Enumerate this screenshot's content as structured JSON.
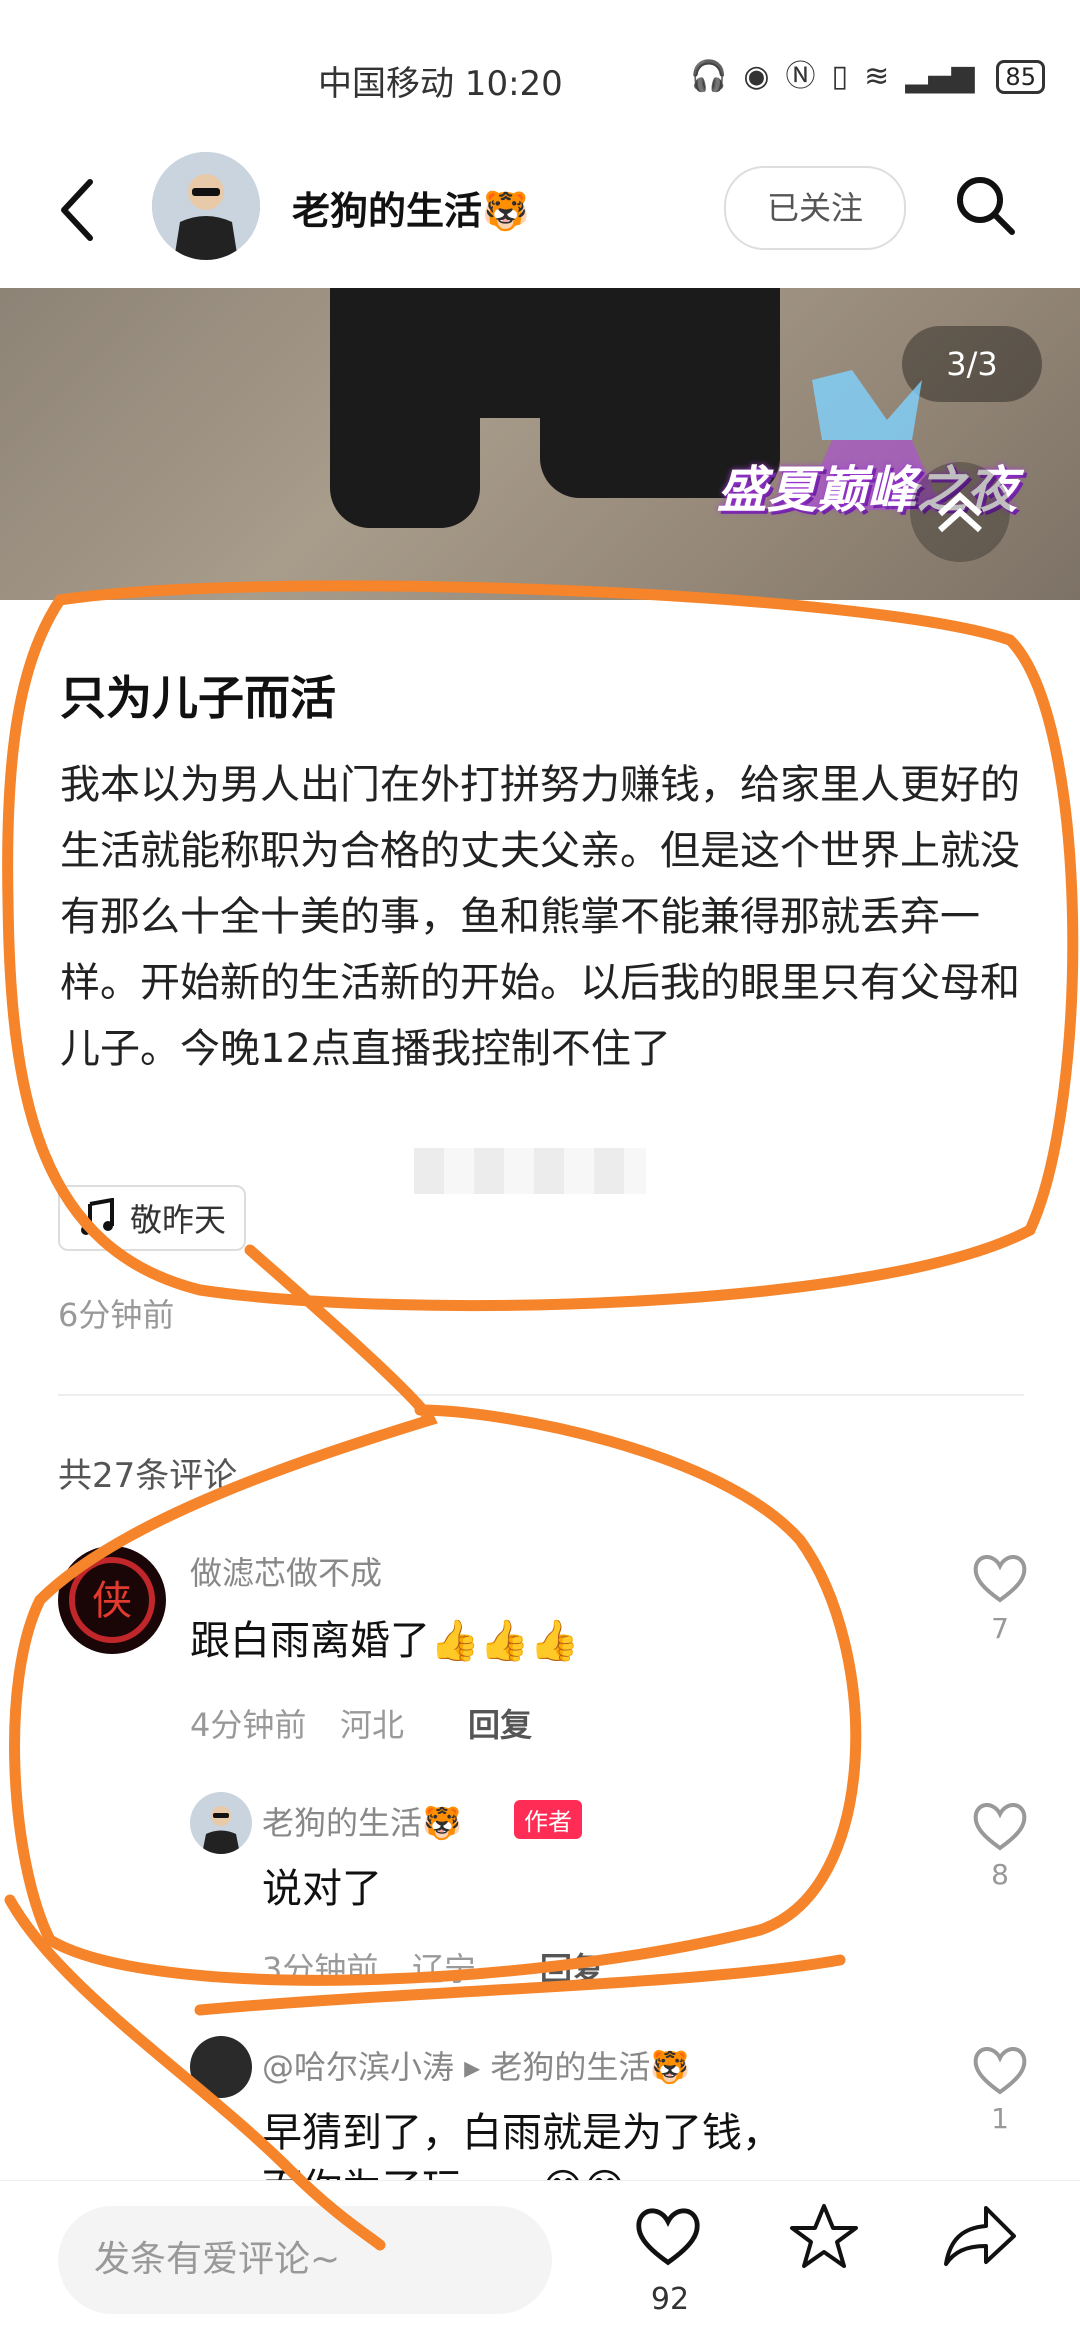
{
  "status_bar": {
    "carrier_time": "中国移动 10:20",
    "battery": "85"
  },
  "header": {
    "author_name": "老狗的生活🐯",
    "follow_label": "已关注"
  },
  "media": {
    "page_counter": "3/3",
    "badge_text": "盛夏巅峰之夜"
  },
  "post": {
    "title": "只为儿子而活",
    "body": "我本以为男人出门在外打拼努力赚钱，给家里人更好的生活就能称职为合格的丈夫父亲。但是这个世界上就没有那么十全十美的事，鱼和熊掌不能兼得那就丢弃一样。开始新的生活新的开始。以后我的眼里只有父母和儿子。今晚12点直播我控制不住了",
    "music": "敬昨天",
    "time": "6分钟前"
  },
  "comments_header": "共27条评论",
  "comments": [
    {
      "name": "做滤芯做不成",
      "text": "跟白雨离婚了👍👍👍",
      "time": "4分钟前",
      "location": "河北",
      "reply_label": "回复",
      "likes": "7"
    },
    {
      "name": "老狗的生活🐯",
      "badge": "作者",
      "text": "说对了",
      "time": "3分钟前",
      "location": "辽宁",
      "reply_label": "回复",
      "likes": "8"
    },
    {
      "name": "@哈尔滨小涛 ▸ 老狗的生活🐯",
      "text": "早猜到了，白雨就是为了钱，",
      "text2": "而你为了玩……😅😅",
      "likes": "1"
    }
  ],
  "bottom_bar": {
    "input_placeholder": "发条有爱评论~",
    "like_count": "92"
  },
  "colors": {
    "annotation": "#f5842a",
    "author_badge": "#ff2d55"
  }
}
